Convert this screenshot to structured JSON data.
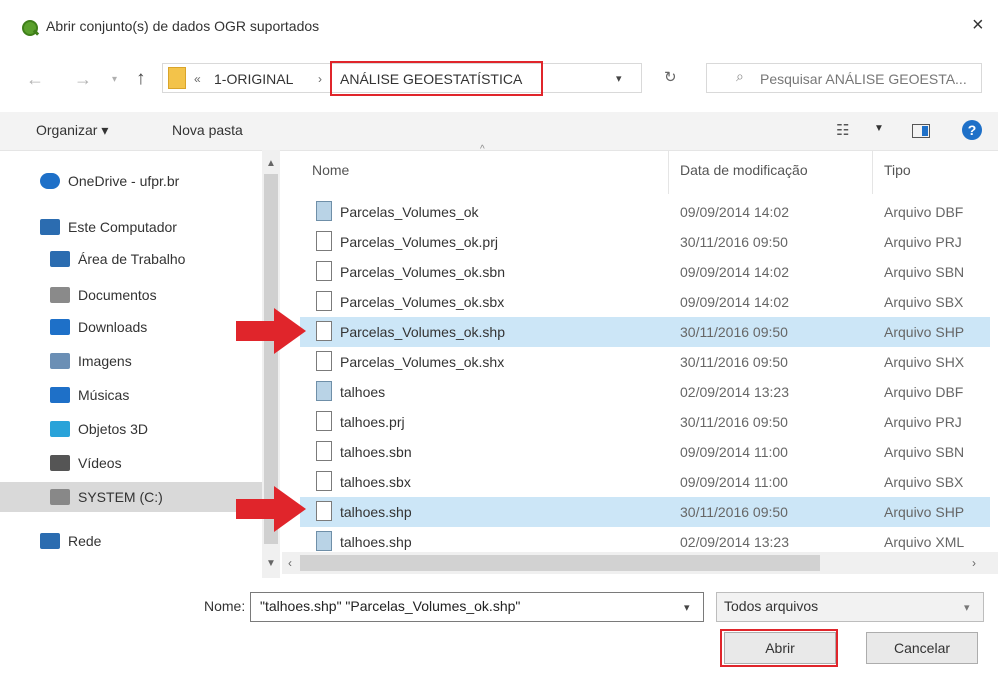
{
  "window": {
    "title": "Abrir conjunto(s) de dados OGR suportados",
    "close": "×"
  },
  "address": {
    "back": "←",
    "forward": "→",
    "up": "↑",
    "crumbs": [
      "«",
      "1-ORIGINAL",
      "›",
      "ANÁLISE GEOESTATÍSTICA"
    ],
    "search_placeholder": "Pesquisar ANÁLISE GEOESTA..."
  },
  "toolbar": {
    "organize": "Organizar ▾",
    "new_folder": "Nova pasta",
    "help": "?"
  },
  "nav": [
    {
      "label": "OneDrive - ufpr.br",
      "icon": "cloud-icon"
    },
    {
      "label": "Este Computador",
      "icon": "computer-icon"
    },
    {
      "label": "Área de Trabalho",
      "icon": "desktop-icon"
    },
    {
      "label": "Documentos",
      "icon": "documents-icon"
    },
    {
      "label": "Downloads",
      "icon": "download-icon"
    },
    {
      "label": "Imagens",
      "icon": "pictures-icon"
    },
    {
      "label": "Músicas",
      "icon": "music-icon"
    },
    {
      "label": "Objetos 3D",
      "icon": "objects-3d-icon"
    },
    {
      "label": "Vídeos",
      "icon": "videos-icon"
    },
    {
      "label": "SYSTEM (C:)",
      "icon": "drive-icon"
    },
    {
      "label": "Rede",
      "icon": "network-icon"
    }
  ],
  "columns": {
    "name": "Nome",
    "date": "Data de modificação",
    "type": "Tipo"
  },
  "files": [
    {
      "name": "Parcelas_Volumes_ok",
      "date": "09/09/2014 14:02",
      "type": "Arquivo DBF",
      "icon": "db-file-icon"
    },
    {
      "name": "Parcelas_Volumes_ok.prj",
      "date": "30/11/2016 09:50",
      "type": "Arquivo PRJ",
      "icon": "file-icon"
    },
    {
      "name": "Parcelas_Volumes_ok.sbn",
      "date": "09/09/2014 14:02",
      "type": "Arquivo SBN",
      "icon": "file-icon"
    },
    {
      "name": "Parcelas_Volumes_ok.sbx",
      "date": "09/09/2014 14:02",
      "type": "Arquivo SBX",
      "icon": "file-icon"
    },
    {
      "name": "Parcelas_Volumes_ok.shp",
      "date": "30/11/2016 09:50",
      "type": "Arquivo SHP",
      "icon": "file-icon"
    },
    {
      "name": "Parcelas_Volumes_ok.shx",
      "date": "30/11/2016 09:50",
      "type": "Arquivo SHX",
      "icon": "file-icon"
    },
    {
      "name": "talhoes",
      "date": "02/09/2014 13:23",
      "type": "Arquivo DBF",
      "icon": "db-file-icon"
    },
    {
      "name": "talhoes.prj",
      "date": "30/11/2016 09:50",
      "type": "Arquivo PRJ",
      "icon": "file-icon"
    },
    {
      "name": "talhoes.sbn",
      "date": "09/09/2014 11:00",
      "type": "Arquivo SBN",
      "icon": "file-icon"
    },
    {
      "name": "talhoes.sbx",
      "date": "09/09/2014 11:00",
      "type": "Arquivo SBX",
      "icon": "file-icon"
    },
    {
      "name": "talhoes.shp",
      "date": "30/11/2016 09:50",
      "type": "Arquivo SHP",
      "icon": "file-icon"
    },
    {
      "name": "talhoes.shp",
      "date": "02/09/2014 13:23",
      "type": "Arquivo XML",
      "icon": "db-file-icon"
    }
  ],
  "bottom": {
    "name_label": "Nome:",
    "name_value": "\"talhoes.shp\" \"Parcelas_Volumes_ok.shp\"",
    "filter": "Todos arquivos",
    "open": "Abrir",
    "cancel": "Cancelar"
  },
  "colors": {
    "highlight_red": "#e0252b",
    "row_selected": "#cce6f7"
  }
}
